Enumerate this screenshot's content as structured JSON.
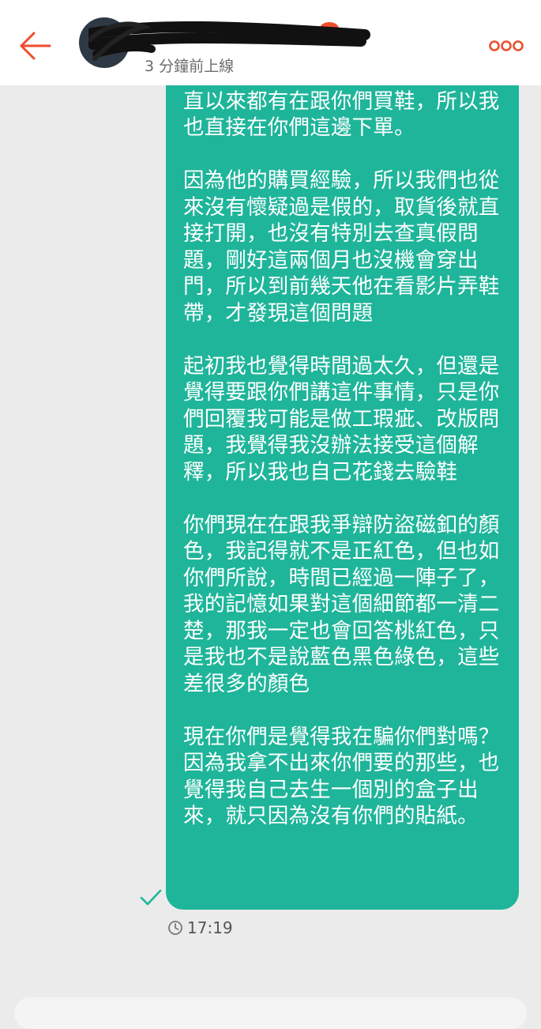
{
  "header": {
    "status": "3 分鐘前上線",
    "back_icon": "arrow-left-icon",
    "more_icon": "more-dots-icon",
    "accent_color": "#ee4d2d"
  },
  "message": {
    "text": "會選擇和你們購買，是因為男友一直以來都有在跟你們買鞋，所以我也直接在你們這邊下單。\n\n因為他的購買經驗，所以我們也從來沒有懷疑過是假的，取貨後就直接打開，也沒有特別去查真假問題，剛好這兩個月也沒機會穿出門，所以到前幾天他在看影片弄鞋帶，才發現這個問題\n\n起初我也覺得時間過太久，但還是覺得要跟你們講這件事情，只是你們回覆我可能是做工瑕疵、改版問題，我覺得我沒辦法接受這個解釋，所以我也自己花錢去驗鞋\n\n你們現在在跟我爭辯防盜磁釦的顏色，我記得就不是正紅色，但也如你們所說，時間已經過一陣子了，我的記憶如果對這個細節都一清二楚，那我一定也會回答桃紅色，只是我也不是說藍色黑色綠色，這些差很多的顏色\n\n現在你們是覺得我在騙你們對嗎？因為我拿不出來你們要的那些，也覺得我自己去生一個別的盒子出來，就只因為沒有你們的貼紙。",
    "bubble_color": "#1fb59a",
    "read_icon": "check-icon",
    "time": "17:19",
    "time_icon": "clock-icon"
  }
}
